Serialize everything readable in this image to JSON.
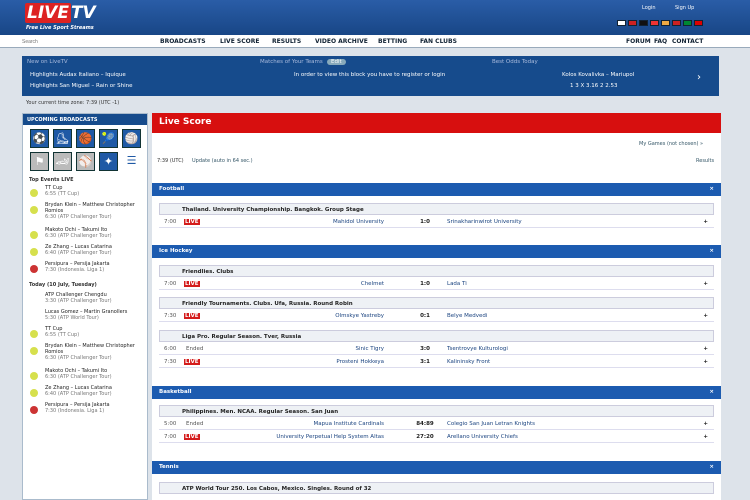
{
  "header": {
    "logo_live": "LIVE",
    "logo_tv": "TV",
    "tagline": "Free Live Sport Streams",
    "login": "Login",
    "signup": "Sign Up"
  },
  "nav": {
    "search_placeholder": "Search",
    "items": [
      "BROADCASTS",
      "LIVE SCORE",
      "RESULTS",
      "VIDEO ARCHIVE",
      "BETTING",
      "FAN CLUBS"
    ],
    "right": [
      "FORUM",
      "FAQ",
      "CONTACT"
    ]
  },
  "newsbar": {
    "new_title": "New on LiveTV",
    "h1": "Highlights Audax Italiano – Iquique",
    "h2": "Highlights San Miguel – Rain or Shine",
    "teams_title": "Matches of Your Teams",
    "teams_btn": "Edit",
    "teams_msg": "In order to view this block you have to register or login",
    "odds_title": "Best Odds Today",
    "odds_match": "Kolos Kovalivka – Mariupol",
    "odds": "1 3 X 3.16 2 2.53",
    "time": "Your current time zone: 7:39 (UTC -1)"
  },
  "sidebar": {
    "title": "UPCOMING BROADCASTS",
    "top": "Top Events LIVE",
    "today": "Today (10 July, Tuesday)",
    "events": [
      [
        "TT Cup",
        "6:55 (TT Cup)"
      ],
      [
        "Brydan Klein – Matthew Christopher Romios",
        "6:30 (ATP Challenger Tour)"
      ],
      [
        "Makoto Ochi – Takumi Ito",
        "6:30 (ATP Challenger Tour)"
      ],
      [
        "Ze Zhang – Lucas Catarina",
        "6:40 (ATP Challenger Tour)"
      ],
      [
        "Persipura – Persija Jakarta",
        "7:30 (Indonesia. Liga 1)"
      ]
    ],
    "events2": [
      [
        "ATP Challenger Chengdu",
        "3:30 (ATP Challenger Tour)"
      ],
      [
        "Lucas Gomez – Martin Granollers",
        "5:30 (ATP World Tour)"
      ],
      [
        "TT Cup",
        "6:55 (TT Cup)"
      ],
      [
        "Brydan Klein – Matthew Christopher Romios",
        "6:30 (ATP Challenger Tour)"
      ],
      [
        "Makoto Ochi – Takumi Ito",
        "6:30 (ATP Challenger Tour)"
      ],
      [
        "Ze Zhang – Lucas Catarina",
        "6:40 (ATP Challenger Tour)"
      ],
      [
        "Persipura – Persija Jakarta",
        "7:30 (Indonesia. Liga 1)"
      ]
    ]
  },
  "main": {
    "title": "Live Score",
    "mygames": "My Games (not chosen) »",
    "time": "7:39 (UTC)",
    "update": "Update (auto in 64 sec.)",
    "results": "Results",
    "football": "Football",
    "fb_league": "Thailand. University Championship. Bangkok. Group Stage",
    "fb": [
      "7:00",
      "LIVE",
      "Mahidol University",
      "1:0",
      "Srinakharinwirot University"
    ],
    "hockey": "Ice Hockey",
    "hk_l1": "Friendlies. Clubs",
    "hk1": [
      "7:00",
      "LIVE",
      "Chelmet",
      "1:0",
      "Lada Ti"
    ],
    "hk_l2": "Friendly Tournaments. Clubs. Ufa, Russia. Round Robin",
    "hk2": [
      "7:30",
      "LIVE",
      "Olmskye Yastreby",
      "0:1",
      "Belye Medvedi"
    ],
    "hk_l3": "Liga Pro. Regular Season. Tver, Russia",
    "hk3": [
      "6:00",
      "Ended",
      "Sinic Tigry",
      "3:0",
      "Tsentrovye Kulturologi"
    ],
    "hk4": [
      "7:30",
      "LIVE",
      "Prosteni Hokkeya",
      "3:1",
      "Kalininsky Front"
    ],
    "basket": "Basketball",
    "bk_l": "Philippines. Men. NCAA. Regular Season. San Juan",
    "bk1": [
      "5:00",
      "Ended",
      "Mapua Institute Cardinals",
      "84:89",
      "Colegio San Juan Letran Knights"
    ],
    "bk2": [
      "7:00",
      "LIVE",
      "University Perpetual Help System Altas",
      "27:20",
      "Arellano University Chiefs"
    ],
    "tennis": "Tennis",
    "tn_l": "ATP World Tour 250. Los Cabos, Mexico. Singles. Round of 32"
  },
  "colors": {
    "brand": "#164b8c",
    "live": "#d70f0f"
  }
}
